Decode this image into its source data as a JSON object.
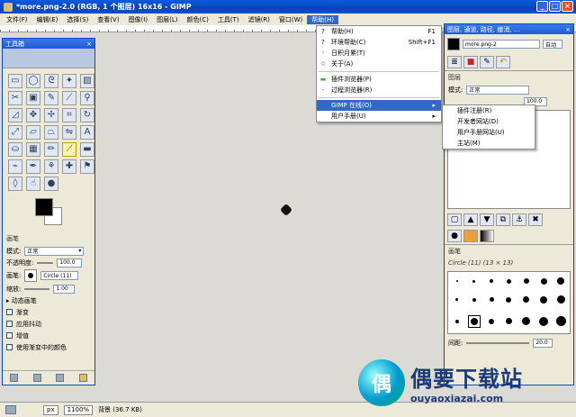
{
  "window": {
    "title": "*more.png-2.0 (RGB, 1 个图层) 16x16 - GIMP",
    "min": "_",
    "max": "□",
    "close": "×"
  },
  "menubar": [
    "文件(F)",
    "编辑(E)",
    "选择(S)",
    "查看(V)",
    "图像(I)",
    "图层(L)",
    "颜色(C)",
    "工具(T)",
    "滤镜(R)",
    "窗口(W)",
    "帮助(H)"
  ],
  "help_menu": {
    "items": [
      {
        "label": "帮助(H)",
        "accel": "F1",
        "icon": "?"
      },
      {
        "label": "环境帮助(C)",
        "accel": "Shift+F1",
        "icon": "?"
      },
      {
        "label": "日积月累(T)",
        "accel": "",
        "icon": "◦"
      },
      {
        "label": "关于(A)",
        "accel": "",
        "icon": "☆"
      }
    ],
    "items2": [
      {
        "label": "插件浏览器(P)",
        "icon": "▬"
      },
      {
        "label": "过程浏览器(R)",
        "icon": "·"
      }
    ],
    "items3": [
      {
        "label": "GIMP 在线(O)",
        "submenu": "▸"
      },
      {
        "label": "用户手册(U)",
        "submenu": "▸"
      }
    ]
  },
  "online_submenu": [
    "插件注册(R)",
    "开发者网站(D)",
    "用户手册网站(U)",
    "主站(M)"
  ],
  "toolbox": {
    "title": "工具箱",
    "close": "×",
    "options_header": "画笔",
    "mode_label": "模式:",
    "mode_value": "正常",
    "opacity_label": "不透明度:",
    "opacity_value": "100.0",
    "brush_label": "画笔:",
    "brush_value": "Circle (11)",
    "scale_label": "缩放:",
    "scale_value": "1.00",
    "dynamics": "▸ 动态画笔",
    "checks": [
      "渐变",
      "应用抖动",
      "增值",
      "使用渐变中的颜色"
    ]
  },
  "dock": {
    "title": "图层, 通道, 路径, 撤消, ...",
    "image_name": "more.png-2",
    "auto_button": "自动",
    "layers_header": "图层",
    "mode_label": "模式:",
    "mode_value": "正常",
    "opacity_value": "100.0",
    "brush_header": "画笔",
    "brush_name": "Circle (11) (13 × 13)",
    "spacing_label": "间距:",
    "spacing_value": "20.0"
  },
  "status": {
    "unit": "px",
    "zoom": "1100%",
    "info": "背景 (36.7 KB)"
  },
  "watermark": {
    "mark": "偶",
    "title": "偶要下载站",
    "url": "ouyaoxiazai.com"
  }
}
